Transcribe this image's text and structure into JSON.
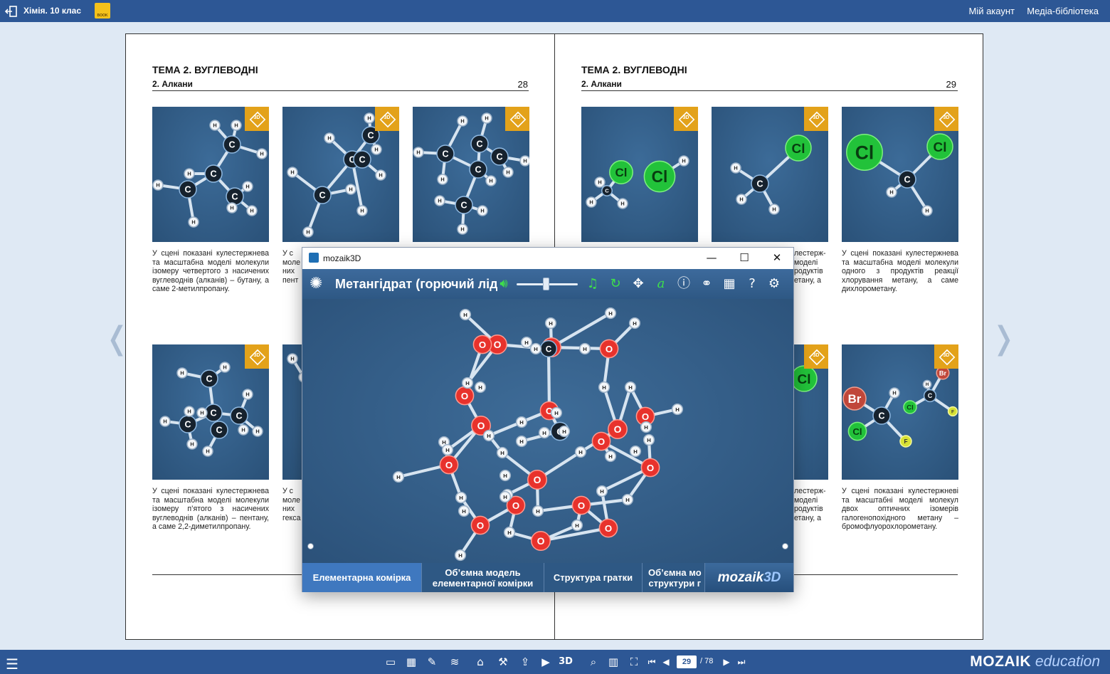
{
  "topbar": {
    "title": "Хімія. 10 клас",
    "book_label": "BOOK",
    "account": "Мій акаунт",
    "media_library": "Медіа-бібліотека"
  },
  "left_page": {
    "header": "ТЕМА 2. ВУГЛЕВОДНІ",
    "subheader": "2. Алкани",
    "page_number": "28",
    "captions": [
      "У сцені показані кулестерж­нева та масштабна моделі молекули ізомеру четверто­го з насичених вуглеводнів (алканів) – бутану, а саме 2-метилпропану.",
      "У с",
      "",
      "У сцені показані кулестерж­нева та масштабна моделі молекули ізомеру п’ятого з насичених вуглеводнів (алка­нів) – пентану, а саме 2,2-ди­метилпропану.",
      "У с",
      ""
    ],
    "caption_fragments_row1": [
      "У с",
      "моле",
      "них",
      "пент"
    ],
    "caption_fragments_row2": [
      "У с",
      "моле",
      "них",
      "гекса"
    ]
  },
  "right_page": {
    "header": "ТЕМА 2. ВУГЛЕВОДНІ",
    "subheader": "2. Алкани",
    "page_number": "29",
    "captions": [
      "У сцені показані кулестерж­нева та масштабна моделі молекули одного з продуктів реакції хлорування метану, а саме дихлорометану.",
      "У сцені показані кулестерж­неві та масштабні моделі мо­лекул двох оптичних ізомерів галогенопохідного метану – бромофлуорохлорометану."
    ],
    "caption_fragments_row1": [
      "лестерж-",
      "моделі",
      "родуктів",
      "етану, а"
    ],
    "caption_fragments_row2": [
      "лестерж-",
      "моделі",
      "родуктів",
      "етану, а"
    ]
  },
  "badge_label": "3D",
  "window": {
    "app_name": "mozaik3D",
    "title": "Метангідрат (горючий лід)",
    "tabs": [
      "Елементарна комірка",
      "Об’ємна модель\nелементарної комірки",
      "Структура гратки",
      "Об’ємна мо\nструктури г"
    ],
    "logo_main": "mozaik",
    "logo_suffix": "3D"
  },
  "atom_labels": {
    "carbon": "C",
    "hydrogen": "H",
    "oxygen": "O",
    "chlorine": "Cl",
    "bromine": "Br",
    "fluorine": "F"
  },
  "bottombar": {
    "current_page": "29",
    "total_pages": "/ 78",
    "brand_main": "MOZAIK",
    "brand_suffix": "education"
  },
  "colors": {
    "bar_blue": "#2d5795",
    "badge_orange": "#e3a21a",
    "scene_blue": "#34618c",
    "oxygen_red": "#e8322c",
    "chlorine_green": "#22c23a"
  }
}
